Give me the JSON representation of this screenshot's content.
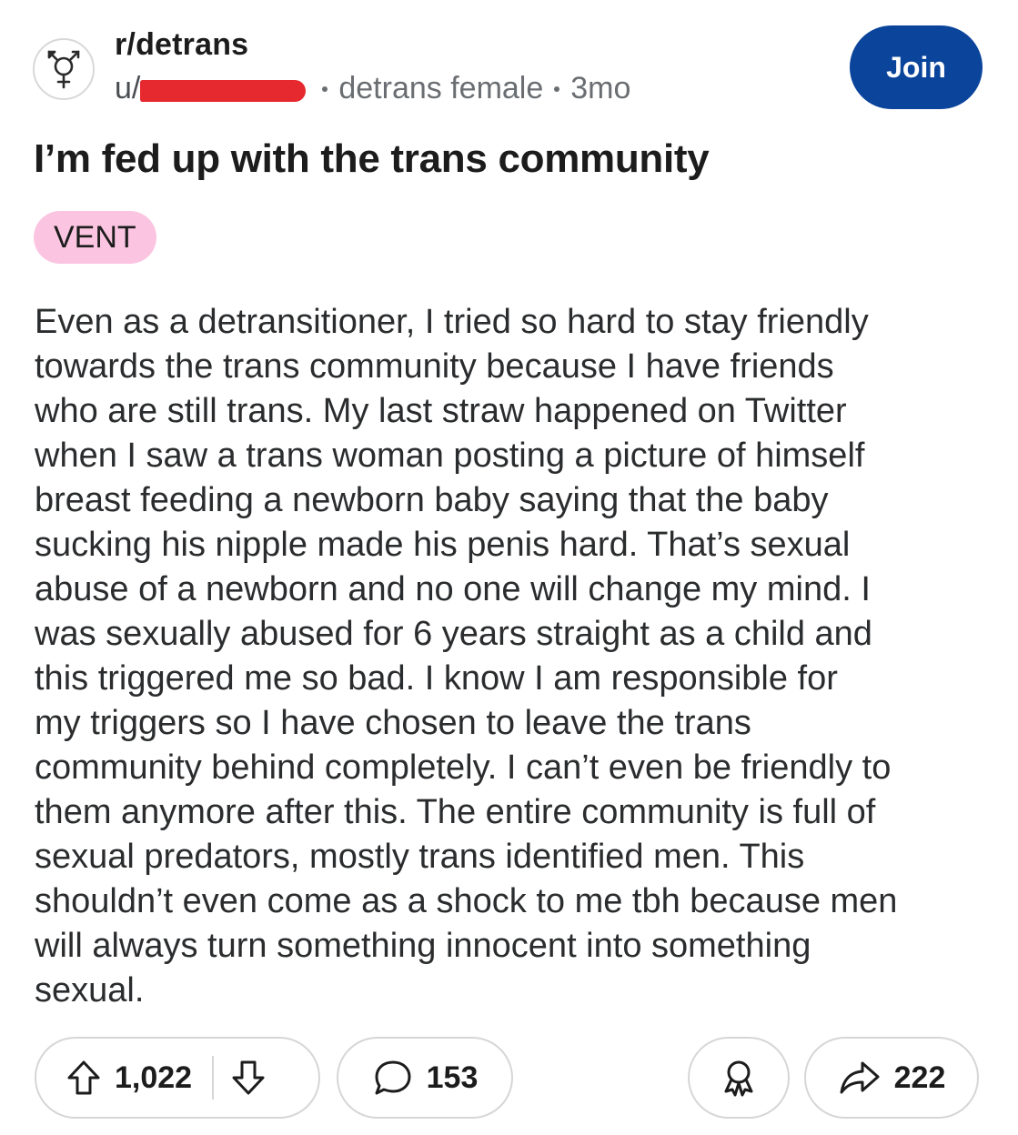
{
  "post": {
    "community": "r/detrans",
    "user_prefix": "u/",
    "user_flair": "detrans female",
    "age": "3mo",
    "join_label": "Join",
    "title": "I’m fed up with the trans community",
    "flair": "VENT",
    "body_lines": [
      "Even as a detransitioner, I tried so hard to stay friendly",
      "towards the trans community because I have friends",
      "who are still trans. My last straw happened on Twitter",
      "when I saw a trans woman posting a picture of himself",
      "breast feeding a newborn baby saying that the baby",
      "sucking his nipple made his penis hard. That’s sexual",
      "abuse of a newborn and no one will change my mind. I",
      "was sexually abused for 6 years straight as a child and",
      "this triggered me so bad. I know I am responsible for",
      "my triggers so I have chosen to leave the trans",
      "community behind completely. I can’t even be friendly to",
      "them anymore after this. The entire community is full of",
      "sexual predators, mostly trans identified men. This",
      "shouldn’t even come as a shock to me tbh because men",
      "will always turn something innocent into something",
      "sexual."
    ]
  },
  "actions": {
    "upvotes": "1,022",
    "comments": "153",
    "shares": "222"
  },
  "icons": {
    "community_avatar": "transgender-symbol-icon",
    "upvote": "arrow-up-icon",
    "downvote": "arrow-down-icon",
    "comment": "speech-bubble-icon",
    "award": "award-ribbon-icon",
    "share": "share-arrow-icon"
  },
  "colors": {
    "join_button": "#0a449b",
    "flair_bg": "#fbc5e1",
    "redaction": "#e5292f"
  }
}
